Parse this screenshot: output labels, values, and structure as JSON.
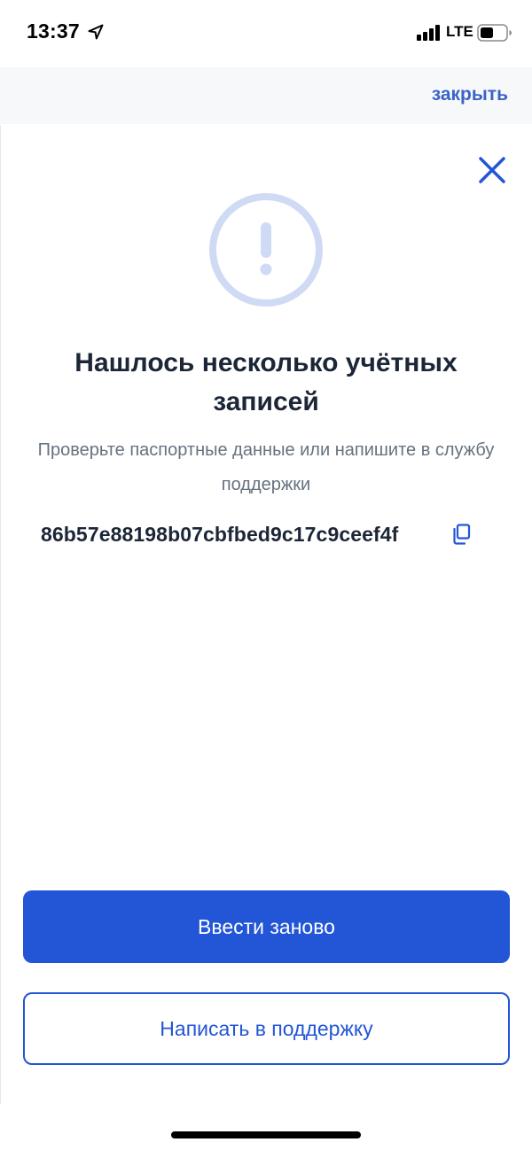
{
  "status_bar": {
    "time": "13:37",
    "network": "LTE",
    "icons": [
      "location-arrow-icon",
      "signal-bars-icon",
      "battery-icon"
    ]
  },
  "header": {
    "close_link": "закрыть"
  },
  "dialog": {
    "close_icon": "close-icon",
    "alert_icon": "exclamation-circle-icon",
    "title": "Нашлось несколько учётных записей",
    "subtitle": "Проверьте паспортные данные или напишите в службу поддержки",
    "error_code": "86b57e88198b07cbfbed9c17c9ceef4f",
    "copy_icon": "copy-icon"
  },
  "actions": {
    "retry_label": "Ввести заново",
    "support_label": "Написать в поддержку"
  },
  "colors": {
    "accent": "#2356d6",
    "link": "#3a63c7",
    "alert_ring": "#cfdaf5",
    "title": "#1c2637",
    "muted": "#66727f"
  }
}
